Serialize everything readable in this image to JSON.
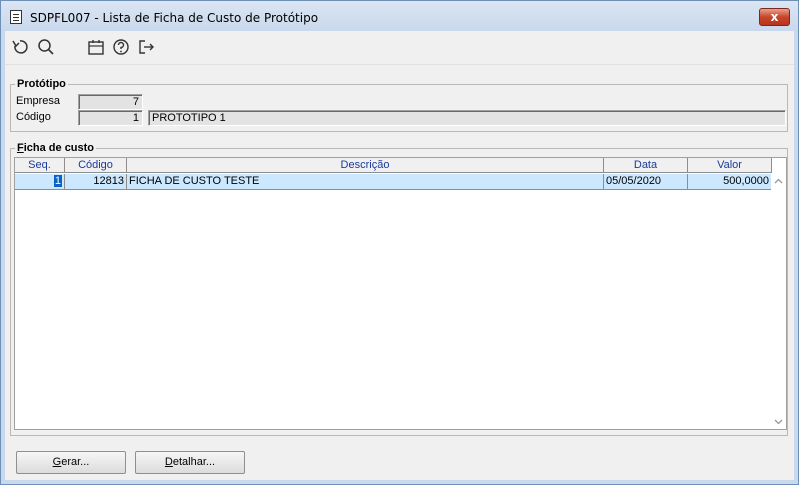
{
  "window": {
    "title": "SDPFL007 - Lista de Ficha de Custo de Protótipo",
    "close_label": "x"
  },
  "toolbar": {
    "icons": [
      "refresh-icon",
      "search-icon",
      "calendar-icon",
      "help-icon",
      "exit-icon"
    ]
  },
  "prototipo": {
    "group_label": "Protótipo",
    "empresa_label": "Empresa",
    "empresa_value": "7",
    "codigo_label": "Código",
    "codigo_value": "1",
    "descricao_value": "PROTOTIPO 1"
  },
  "ficha": {
    "group_label_first": "F",
    "group_label_rest": "icha de custo",
    "columns": [
      "Seq.",
      "Código",
      "Descrição",
      "Data",
      "Valor"
    ],
    "rows": [
      {
        "seq": "1",
        "codigo": "12813",
        "descricao": "FICHA DE CUSTO TESTE",
        "data": "05/05/2020",
        "valor": "500,0000"
      }
    ]
  },
  "buttons": {
    "gerar_first": "G",
    "gerar_rest": "erar...",
    "detalhar_first": "D",
    "detalhar_rest": "etalhar..."
  }
}
